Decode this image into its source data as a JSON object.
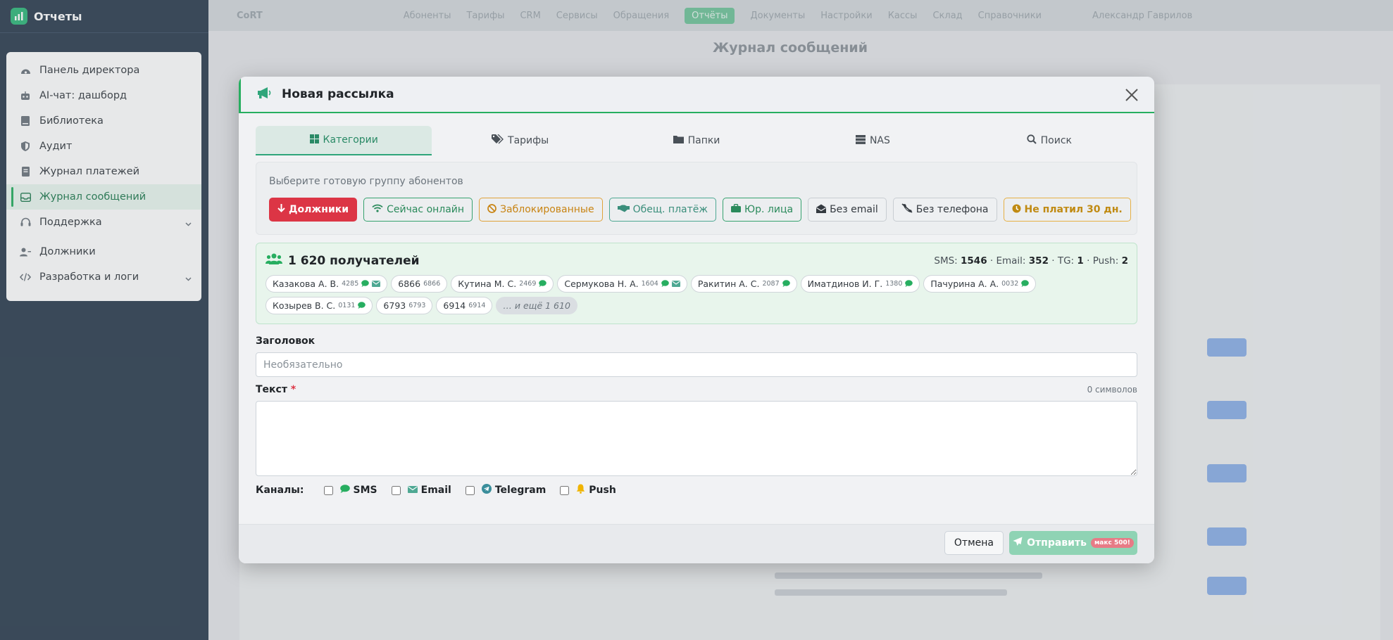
{
  "sidebar": {
    "title": "Отчеты",
    "items": [
      {
        "label": "Панель директора"
      },
      {
        "label": "AI-чат: дашборд"
      },
      {
        "label": "Библиотека"
      },
      {
        "label": "Аудит"
      },
      {
        "label": "Журнал платежей"
      },
      {
        "label": "Журнал сообщений"
      },
      {
        "label": "Поддержка"
      },
      {
        "label": "Должники"
      },
      {
        "label": "Разработка и логи"
      }
    ]
  },
  "background": {
    "brand": "CoRT",
    "page_title": "Журнал сообщений",
    "nav": [
      "Абоненты",
      "Тарифы",
      "CRM",
      "Сервисы",
      "Обращения",
      "Отчёты",
      "Документы",
      "Настройки",
      "Кассы",
      "Склад",
      "Справочники"
    ],
    "user": "Александр Гаврилов"
  },
  "modal": {
    "title": "Новая рассылка",
    "tabs": [
      {
        "label": "Категории"
      },
      {
        "label": "Тарифы"
      },
      {
        "label": "Папки"
      },
      {
        "label": "NAS"
      },
      {
        "label": "Поиск"
      }
    ],
    "hint": "Выберите готовую группу абонентов",
    "categories": [
      {
        "label": "Должники"
      },
      {
        "label": "Сейчас онлайн"
      },
      {
        "label": "Заблокированные"
      },
      {
        "label": "Обещ. платёж"
      },
      {
        "label": "Юр. лица"
      },
      {
        "label": "Без email"
      },
      {
        "label": "Без телефона"
      },
      {
        "label": "Не платил 30 дн."
      }
    ],
    "recipients": {
      "count_label": "1 620 получателей",
      "sms_label": "SMS:",
      "sms": "1546",
      "email_label": "Email:",
      "email": "352",
      "tg_label": "TG:",
      "tg": "1",
      "push_label": "Push:",
      "push": "2",
      "list": [
        {
          "name": "Казакова А. В.",
          "id": "4285"
        },
        {
          "name": "6866",
          "id": "6866"
        },
        {
          "name": "Кутина М. С.",
          "id": "2469"
        },
        {
          "name": "Сермукова Н. А.",
          "id": "1604"
        },
        {
          "name": "Ракитин А. С.",
          "id": "2087"
        },
        {
          "name": "Иматдинов И. Г.",
          "id": "1380"
        },
        {
          "name": "Пачурина А. А.",
          "id": "0032"
        },
        {
          "name": "Козырев В. С.",
          "id": "0131"
        },
        {
          "name": "6793",
          "id": "6793"
        },
        {
          "name": "6914",
          "id": "6914"
        }
      ],
      "more": "… и ещё 1 610"
    },
    "subject": {
      "label": "Заголовок",
      "placeholder": "Необязательно",
      "value": ""
    },
    "text": {
      "label": "Текст",
      "required_mark": "*",
      "counter": "0 символов",
      "value": ""
    },
    "channels": {
      "label": "Каналы:",
      "items": [
        {
          "label": "SMS"
        },
        {
          "label": "Email"
        },
        {
          "label": "Telegram"
        },
        {
          "label": "Push"
        }
      ]
    },
    "cancel": "Отмена",
    "send": "Отправить",
    "send_badge": "макс 500!"
  },
  "colors": {
    "accent": "#27ae60",
    "danger": "#dc3545",
    "sidebar_bg": "#2c3e50"
  }
}
